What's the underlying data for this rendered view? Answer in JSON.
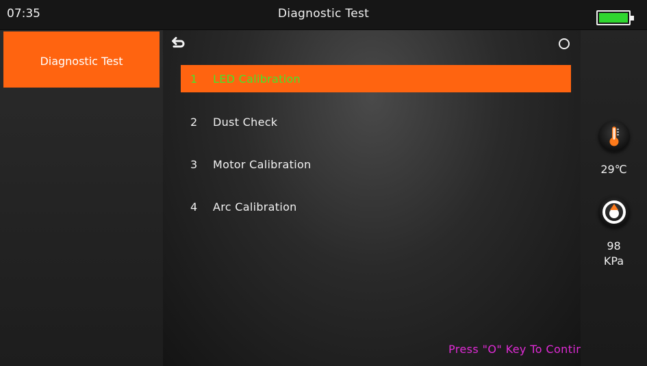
{
  "status_bar": {
    "time": "07:35",
    "title": "Diagnostic Test",
    "battery_level": 1.0,
    "battery_color": "#2fd62f"
  },
  "sidebar": {
    "items": [
      {
        "label": "Diagnostic Test",
        "active": true
      }
    ]
  },
  "menu": {
    "items": [
      {
        "number": "1",
        "label": "LED Calibration",
        "selected": true
      },
      {
        "number": "2",
        "label": "Dust Check",
        "selected": false
      },
      {
        "number": "3",
        "label": "Motor Calibration",
        "selected": false
      },
      {
        "number": "4",
        "label": "Arc Calibration",
        "selected": false
      }
    ]
  },
  "hint": "Press \"O\" Key To Continue",
  "sensors": {
    "temperature": "29℃",
    "pressure_value": "98",
    "pressure_unit": "KPa"
  },
  "colors": {
    "accent": "#ff6410",
    "selected_text": "#45e62b",
    "hint_text": "#e02bd6"
  },
  "icons": {
    "back": "back-arrow-icon",
    "confirm": "circle-o-icon",
    "temperature": "thermometer-icon",
    "pressure": "pressure-gauge-icon",
    "battery": "battery-icon"
  }
}
